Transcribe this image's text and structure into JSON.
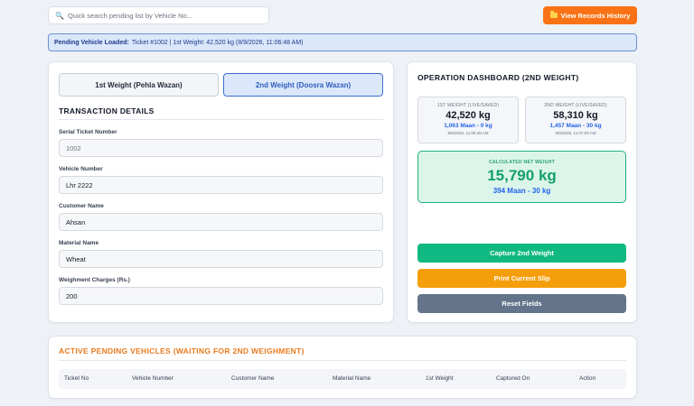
{
  "search": {
    "placeholder": "Quick search pending list by Vehicle No..."
  },
  "header": {
    "history_label": "View Records History"
  },
  "banner": {
    "title": "Pending Vehicle Loaded:",
    "text": "Ticket #1002 | 1st Weight: 42,520 kg (8/9/2026, 11:06:48 AM)"
  },
  "tabs": [
    {
      "label": "1st Weight (Pehla Wazan)"
    },
    {
      "label": "2nd Weight (Doosra Wazan)"
    }
  ],
  "transaction": {
    "title": "TRANSACTION DETAILS",
    "fields": [
      {
        "label": "Serial Ticket Number",
        "value": "1002"
      },
      {
        "label": "Vehicle Number",
        "value": "Lhr 2222"
      },
      {
        "label": "Customer Name",
        "value": "Ahsan"
      },
      {
        "label": "Material Name",
        "value": "Wheat"
      },
      {
        "label": "Weighment Charges (Rs.)",
        "value": "200"
      }
    ]
  },
  "dashboard": {
    "title": "OPERATION DASHBOARD (2ND WEIGHT)",
    "first": {
      "caption": "1ST WEIGHT (LIVE/SAVED)",
      "kg": "42,520 kg",
      "maan": "1,063 Maan - 0 kg",
      "timestamp": "8/9/2026, 11:06:48 AM"
    },
    "second": {
      "caption": "2ND WEIGHT (LIVE/SAVED)",
      "kg": "58,310 kg",
      "maan": "1,457 Maan - 30 kg",
      "timestamp": "8/9/2026, 11:07:03 AM"
    },
    "net": {
      "caption": "CALCULATED NET WEIGHT",
      "kg": "15,790 kg",
      "maan": "394 Maan - 30 kg"
    },
    "buttons": {
      "capture": "Capture 2nd Weight",
      "print": "Print Current Slip",
      "reset": "Reset Fields"
    }
  },
  "pending": {
    "title": "ACTIVE PENDING VEHICLES (WAITING FOR 2ND WEIGHMENT)",
    "columns": [
      "Ticket No",
      "Vehicle Number",
      "Customer Name",
      "Material Name",
      "1st Weight",
      "Captured On",
      "Action"
    ]
  },
  "colors": {
    "accent": "#f97316",
    "primary": "#2563eb",
    "success": "#10b981",
    "warning": "#f59e0b",
    "neutral": "#64748b"
  }
}
